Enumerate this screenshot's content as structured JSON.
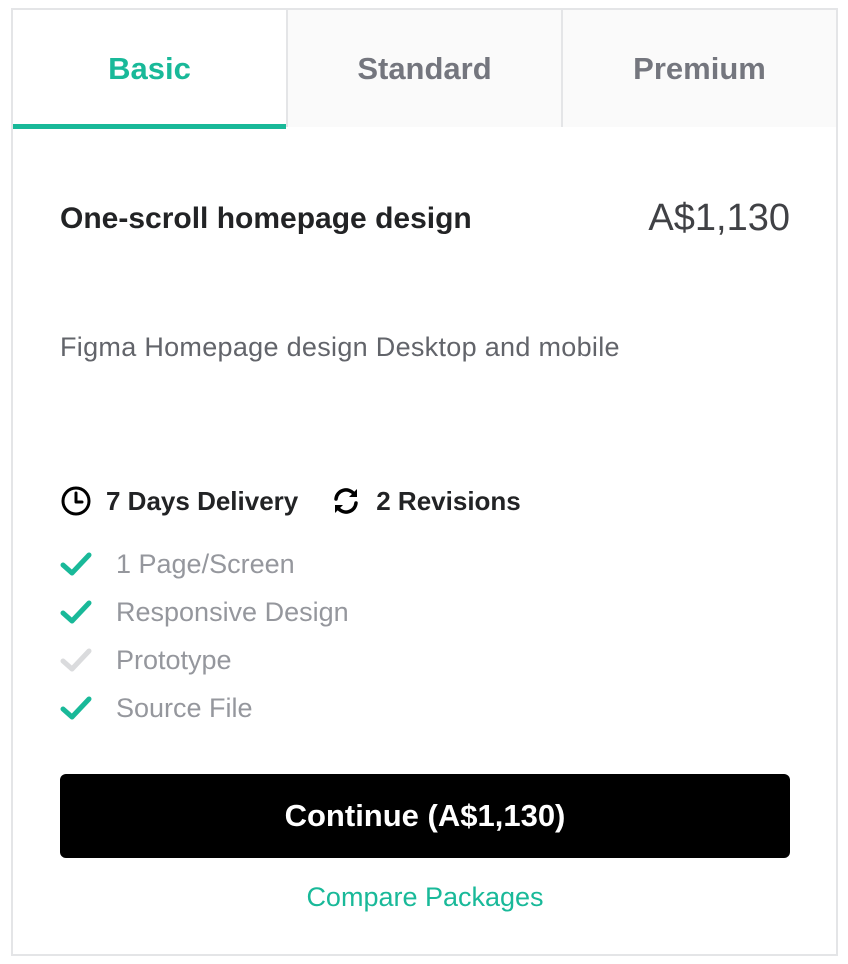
{
  "tabs": [
    {
      "label": "Basic",
      "active": true
    },
    {
      "label": "Standard",
      "active": false
    },
    {
      "label": "Premium",
      "active": false
    }
  ],
  "package": {
    "title": "One-scroll homepage design",
    "price": "A$1,130",
    "description": "Figma Homepage design Desktop and mobile"
  },
  "meta": {
    "delivery": "7 Days Delivery",
    "delivery_icon": "clock-icon",
    "revisions": "2 Revisions",
    "revisions_icon": "refresh-icon"
  },
  "features": [
    {
      "label": "1 Page/Screen",
      "included": true
    },
    {
      "label": "Responsive Design",
      "included": true
    },
    {
      "label": "Prototype",
      "included": false
    },
    {
      "label": "Source File",
      "included": true
    }
  ],
  "continue_label": "Continue (A$1,130)",
  "compare_label": "Compare Packages",
  "colors": {
    "accent": "#19b999",
    "check_on": "#19b999",
    "check_off": "#dadbdd",
    "button_bg": "#000000"
  }
}
